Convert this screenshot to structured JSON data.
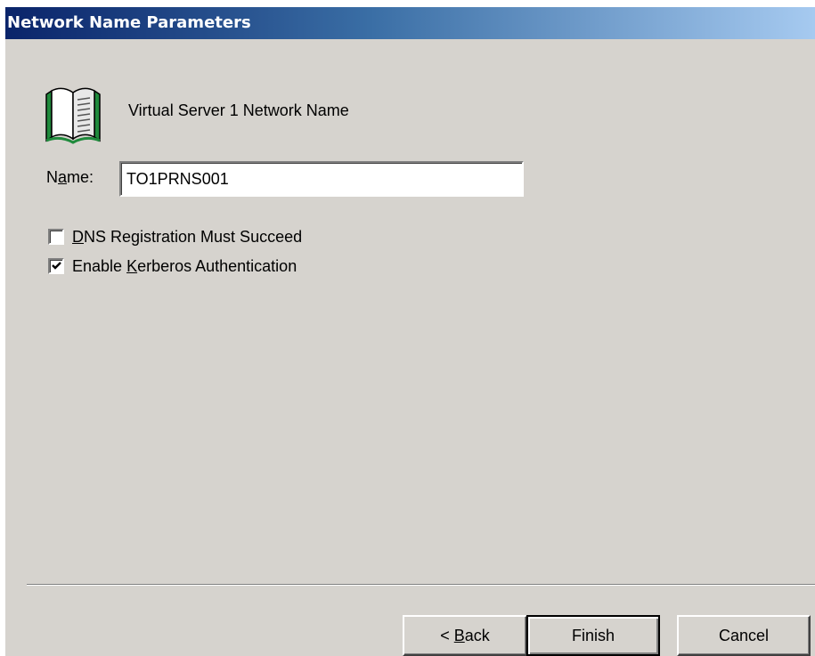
{
  "dialog": {
    "title": "Network Name Parameters",
    "resource_label": "Virtual Server 1 Network Name",
    "resource_icon": "book-icon"
  },
  "form": {
    "name_label_pre": "N",
    "name_label_mnemonic": "a",
    "name_label_post": "me:",
    "name_value": "TO1PRNS001",
    "dns_checkbox": {
      "mnemonic": "D",
      "label_rest": "NS Registration Must Succeed",
      "checked": false
    },
    "kerberos_checkbox": {
      "label_pre": "Enable ",
      "mnemonic": "K",
      "label_rest": "erberos Authentication",
      "checked": true
    }
  },
  "buttons": {
    "back_prefix": "< ",
    "back_mnemonic": "B",
    "back_rest": "ack",
    "finish": "Finish",
    "cancel": "Cancel"
  },
  "colors": {
    "dialog_background": "#d6d3ce",
    "title_gradient_start": "#0a246a",
    "title_gradient_end": "#a6caf0",
    "icon_green": "#1f8a3c"
  }
}
